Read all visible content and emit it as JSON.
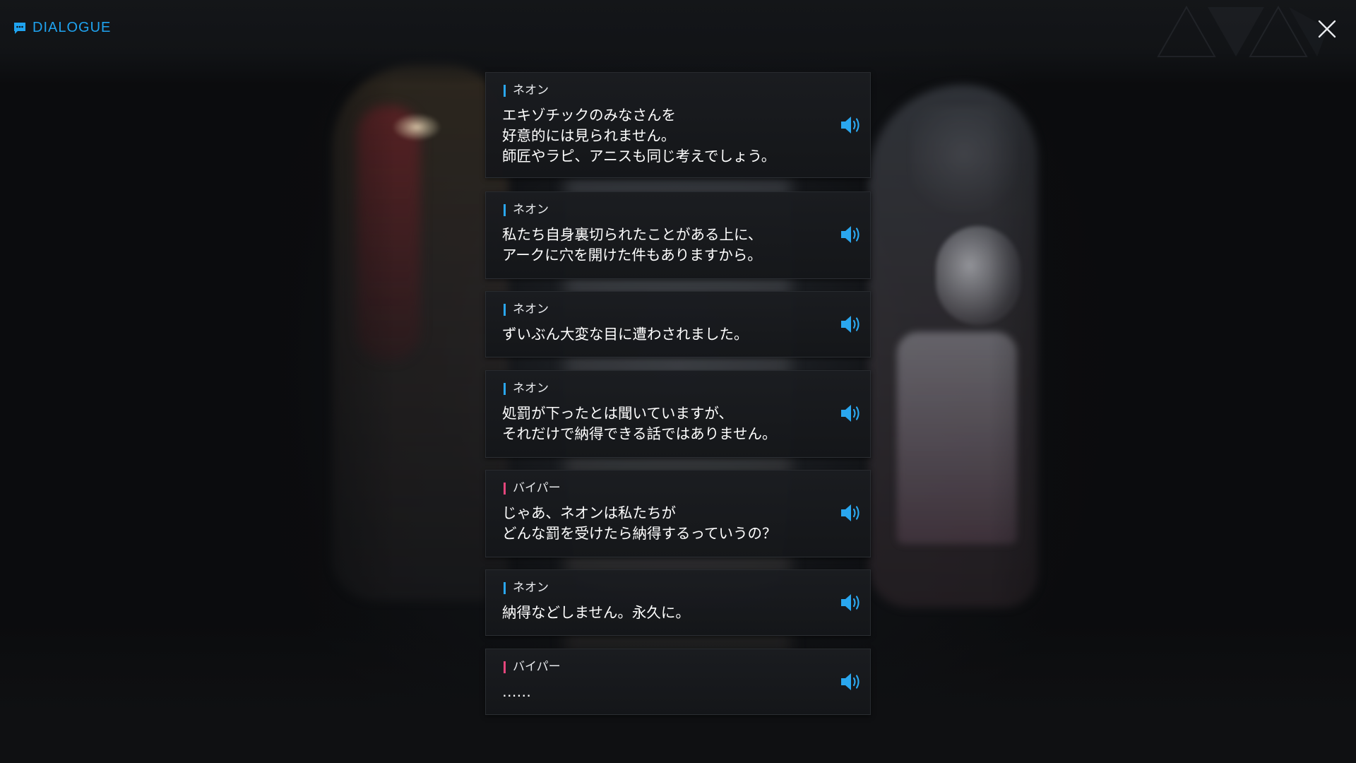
{
  "header": {
    "title": "DIALOGUE",
    "title_icon": "chat-bubble-icon",
    "close_icon": "close-icon",
    "accent_color": "#1fa3f0"
  },
  "speaker_colors": {
    "ネオン": "#2aa7ef",
    "バイパー": "#e5467c"
  },
  "dialogue": [
    {
      "speaker": "ネオン",
      "text": "エキゾチックのみなさんを\n好意的には見られません。\n師匠やラピ、アニスも同じ考えでしょう。"
    },
    {
      "speaker": "ネオン",
      "text": "私たち自身裏切られたことがある上に、\nアークに穴を開けた件もありますから。"
    },
    {
      "speaker": "ネオン",
      "text": "ずいぶん大変な目に遭わされました。"
    },
    {
      "speaker": "ネオン",
      "text": "処罰が下ったとは聞いていますが、\nそれだけで納得できる話ではありません。"
    },
    {
      "speaker": "バイパー",
      "text": "じゃあ、ネオンは私たちが\nどんな罰を受けたら納得するっていうの？"
    },
    {
      "speaker": "ネオン",
      "text": "納得などしません。永久に。"
    },
    {
      "speaker": "バイパー",
      "text": "……"
    }
  ],
  "voice_icon": "speaker-volume-icon"
}
